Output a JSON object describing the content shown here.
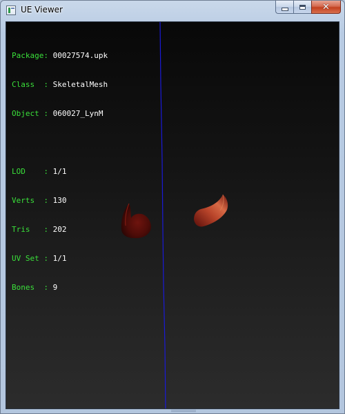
{
  "window": {
    "title": "UE Viewer"
  },
  "caption_buttons": {
    "minimize": "minimize",
    "maximize": "maximize",
    "close": "close"
  },
  "mesh_info": {
    "package": {
      "key": "Package:",
      "value": "00027574.upk"
    },
    "class": {
      "key": "Class  :",
      "value": "SkeletalMesh"
    },
    "object": {
      "key": "Object :",
      "value": "060027_LynM"
    },
    "lod": {
      "key": "LOD    :",
      "value": "1/1"
    },
    "verts": {
      "key": "Verts  :",
      "value": "130"
    },
    "tris": {
      "key": "Tris   :",
      "value": "202"
    },
    "uv_set": {
      "key": "UV Set :",
      "value": "1/1"
    },
    "bones": {
      "key": "Bones  :",
      "value": "9"
    }
  },
  "colors": {
    "label": "#3ae03a",
    "value": "#ffffff",
    "axis": "#1a1ad8",
    "mesh": "#8a1a12"
  },
  "icons": {
    "app": "ue-viewer-app-icon",
    "minimize": "minimize-icon",
    "maximize": "maximize-icon",
    "close": "close-icon"
  }
}
